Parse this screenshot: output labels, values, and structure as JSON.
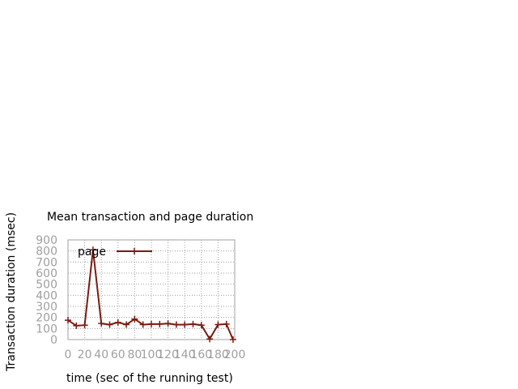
{
  "chart_data": {
    "type": "line",
    "title": "Mean transaction and page duration",
    "xlabel": "time (sec of the running test)",
    "ylabel": "Transaction duration (msec)",
    "xlim": [
      0,
      200
    ],
    "ylim": [
      0,
      900
    ],
    "xticks": [
      0,
      20,
      40,
      60,
      80,
      100,
      120,
      140,
      160,
      180,
      200
    ],
    "yticks": [
      0,
      100,
      200,
      300,
      400,
      500,
      600,
      700,
      800,
      900
    ],
    "grid": true,
    "legend": "top-left",
    "series": [
      {
        "name": "page",
        "color": "#7a1c10",
        "x": [
          0,
          10,
          20,
          30,
          40,
          50,
          60,
          70,
          80,
          90,
          100,
          110,
          120,
          130,
          140,
          150,
          160,
          170,
          180,
          190,
          198
        ],
        "y": [
          175,
          125,
          130,
          810,
          145,
          135,
          155,
          135,
          185,
          135,
          140,
          140,
          145,
          135,
          135,
          140,
          130,
          5,
          135,
          140,
          0
        ]
      }
    ]
  }
}
